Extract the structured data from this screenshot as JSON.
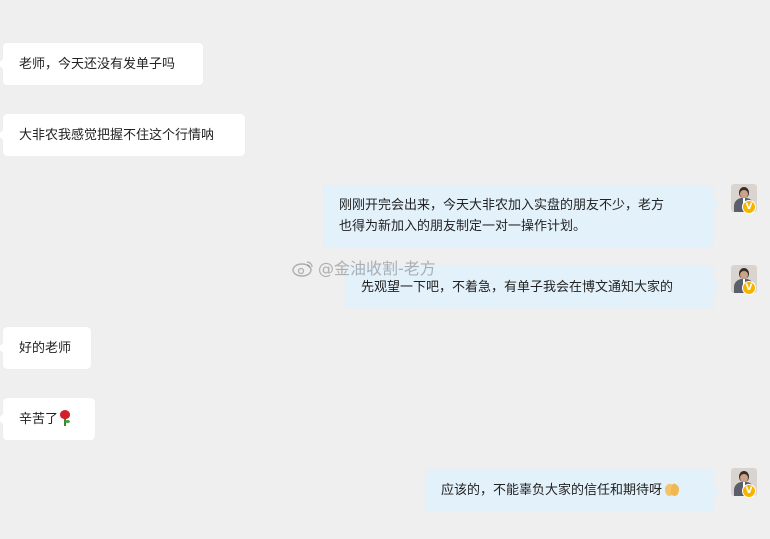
{
  "messages": [
    {
      "side": "left",
      "text": "老师，今天还没有发单子吗"
    },
    {
      "side": "left",
      "text": "大非农我感觉把握不住这个行情呐"
    },
    {
      "side": "right",
      "lines": [
        "刚刚开完会出来，今天大非农加入实盘的朋友不少，老方",
        "也得为新加入的朋友制定一对一操作计划。"
      ]
    },
    {
      "side": "right",
      "text": "先观望一下吧，不着急，有单子我会在博文通知大家的"
    },
    {
      "side": "left",
      "text": "好的老师"
    },
    {
      "side": "left",
      "text": "辛苦了",
      "emoji": "rose-icon"
    },
    {
      "side": "right",
      "text": "应该的，不能辜负大家的信任和期待呀",
      "emoji": "praying-hands-icon"
    }
  ],
  "watermark": {
    "text": "@金油收割-老方",
    "icon": "weibo-logo-icon"
  },
  "avatar": {
    "badge": "V",
    "badge_color": "#f5b400"
  },
  "colors": {
    "background": "#efefef",
    "incoming_bubble": "#ffffff",
    "outgoing_bubble": "#e3f1fb"
  }
}
